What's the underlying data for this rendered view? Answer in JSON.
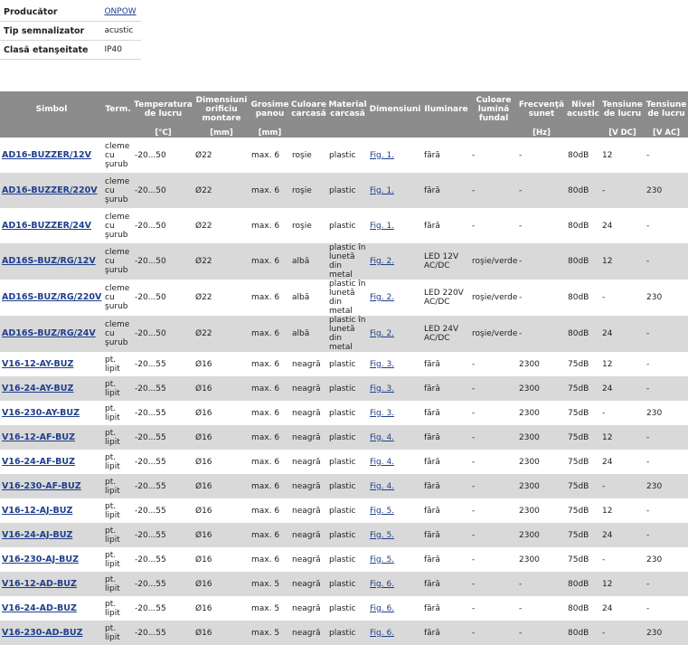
{
  "filters": [
    {
      "label": "Producător",
      "value": "ONPOW",
      "link": true
    },
    {
      "label": "Tip semnalizator",
      "value": "acustic",
      "link": false
    },
    {
      "label": "Clasă etanşeitate",
      "value": "IP40",
      "link": false
    }
  ],
  "columns": [
    {
      "label": "Simbol",
      "unit": ""
    },
    {
      "label": "Term.",
      "unit": ""
    },
    {
      "label": "Temperatura de lucru",
      "unit": "[°C]"
    },
    {
      "label": "Dimensiuni orificiu montare",
      "unit": "[mm]"
    },
    {
      "label": "Grosime panou",
      "unit": "[mm]"
    },
    {
      "label": "Culoare carcasă",
      "unit": ""
    },
    {
      "label": "Material carcasă",
      "unit": ""
    },
    {
      "label": "Dimensiuni",
      "unit": ""
    },
    {
      "label": "Iluminare",
      "unit": ""
    },
    {
      "label": "Culoare lumină fundal",
      "unit": ""
    },
    {
      "label": "Frecvenţă sunet",
      "unit": "[Hz]"
    },
    {
      "label": "Nivel acustic",
      "unit": ""
    },
    {
      "label": "Tensiune de lucru",
      "unit": "[V DC]"
    },
    {
      "label": "Tensiune de lucru",
      "unit": "[V AC]"
    }
  ],
  "rows": [
    [
      "AD16-BUZZER/12V",
      "cleme cu şurub",
      "-20...50",
      "Ø22",
      "max. 6",
      "roşie",
      "plastic",
      "Fig. 1.",
      "fără",
      "-",
      "-",
      "80dB",
      "12",
      "-"
    ],
    [
      "AD16-BUZZER/220V",
      "cleme cu şurub",
      "-20...50",
      "Ø22",
      "max. 6",
      "roşie",
      "plastic",
      "Fig. 1.",
      "fără",
      "-",
      "-",
      "80dB",
      "-",
      "230"
    ],
    [
      "AD16-BUZZER/24V",
      "cleme cu şurub",
      "-20...50",
      "Ø22",
      "max. 6",
      "roşie",
      "plastic",
      "Fig. 1.",
      "fără",
      "-",
      "-",
      "80dB",
      "24",
      "-"
    ],
    [
      "AD16S-BUZ/RG/12V",
      "cleme cu şurub",
      "-20...50",
      "Ø22",
      "max. 6",
      "albă",
      "plastic în lunetă din metal",
      "Fig. 2.",
      "LED 12V AC/DC",
      "roşie/verde",
      "-",
      "80dB",
      "12",
      "-"
    ],
    [
      "AD16S-BUZ/RG/220V",
      "cleme cu şurub",
      "-20...50",
      "Ø22",
      "max. 6",
      "albă",
      "plastic în lunetă din metal",
      "Fig. 2.",
      "LED 220V AC/DC",
      "roşie/verde",
      "-",
      "80dB",
      "-",
      "230"
    ],
    [
      "AD16S-BUZ/RG/24V",
      "cleme cu şurub",
      "-20...50",
      "Ø22",
      "max. 6",
      "albă",
      "plastic în lunetă din metal",
      "Fig. 2.",
      "LED 24V AC/DC",
      "roşie/verde",
      "-",
      "80dB",
      "24",
      "-"
    ],
    [
      "V16-12-AY-BUZ",
      "pt. lipit",
      "-20...55",
      "Ø16",
      "max. 6",
      "neagră",
      "plastic",
      "Fig. 3.",
      "fără",
      "-",
      "2300",
      "75dB",
      "12",
      "-"
    ],
    [
      "V16-24-AY-BUZ",
      "pt. lipit",
      "-20...55",
      "Ø16",
      "max. 6",
      "neagră",
      "plastic",
      "Fig. 3.",
      "fără",
      "-",
      "2300",
      "75dB",
      "24",
      "-"
    ],
    [
      "V16-230-AY-BUZ",
      "pt. lipit",
      "-20...55",
      "Ø16",
      "max. 6",
      "neagră",
      "plastic",
      "Fig. 3.",
      "fără",
      "-",
      "2300",
      "75dB",
      "-",
      "230"
    ],
    [
      "V16-12-AF-BUZ",
      "pt. lipit",
      "-20...55",
      "Ø16",
      "max. 6",
      "neagră",
      "plastic",
      "Fig. 4.",
      "fără",
      "-",
      "2300",
      "75dB",
      "12",
      "-"
    ],
    [
      "V16-24-AF-BUZ",
      "pt. lipit",
      "-20...55",
      "Ø16",
      "max. 6",
      "neagră",
      "plastic",
      "Fig. 4.",
      "fără",
      "-",
      "2300",
      "75dB",
      "24",
      "-"
    ],
    [
      "V16-230-AF-BUZ",
      "pt. lipit",
      "-20...55",
      "Ø16",
      "max. 6",
      "neagră",
      "plastic",
      "Fig. 4.",
      "fără",
      "-",
      "2300",
      "75dB",
      "-",
      "230"
    ],
    [
      "V16-12-AJ-BUZ",
      "pt. lipit",
      "-20...55",
      "Ø16",
      "max. 6",
      "neagră",
      "plastic",
      "Fig. 5.",
      "fără",
      "-",
      "2300",
      "75dB",
      "12",
      "-"
    ],
    [
      "V16-24-AJ-BUZ",
      "pt. lipit",
      "-20...55",
      "Ø16",
      "max. 6",
      "neagră",
      "plastic",
      "Fig. 5.",
      "fără",
      "-",
      "2300",
      "75dB",
      "24",
      "-"
    ],
    [
      "V16-230-AJ-BUZ",
      "pt. lipit",
      "-20...55",
      "Ø16",
      "max. 6",
      "neagră",
      "plastic",
      "Fig. 5.",
      "fără",
      "-",
      "2300",
      "75dB",
      "-",
      "230"
    ],
    [
      "V16-12-AD-BUZ",
      "pt. lipit",
      "-20...55",
      "Ø16",
      "max. 5",
      "neagră",
      "plastic",
      "Fig. 6.",
      "fără",
      "-",
      "-",
      "80dB",
      "12",
      "-"
    ],
    [
      "V16-24-AD-BUZ",
      "pt. lipit",
      "-20...55",
      "Ø16",
      "max. 5",
      "neagră",
      "plastic",
      "Fig. 6.",
      "fără",
      "-",
      "-",
      "80dB",
      "24",
      "-"
    ],
    [
      "V16-230-AD-BUZ",
      "pt. lipit",
      "-20...55",
      "Ø16",
      "max. 5",
      "neagră",
      "plastic",
      "Fig. 6.",
      "fără",
      "-",
      "-",
      "80dB",
      "-",
      "230"
    ]
  ],
  "colors": {
    "header_bg": "#8c8c8c",
    "stripe_bg": "#d9d9d9",
    "link": "#1f3f8c"
  }
}
